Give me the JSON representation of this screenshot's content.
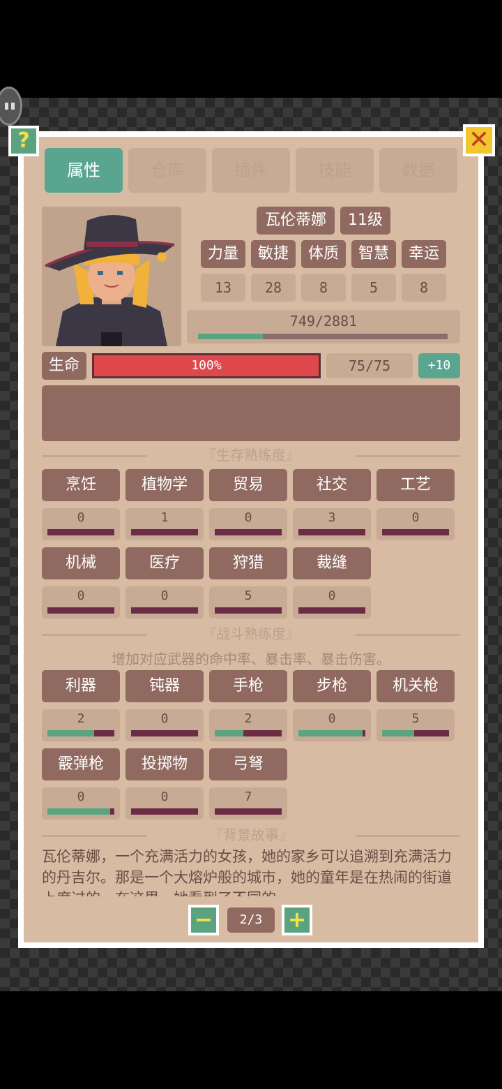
{
  "tabs": [
    {
      "label": "属性",
      "active": true
    },
    {
      "label": "仓库"
    },
    {
      "label": "插件"
    },
    {
      "label": "技能"
    },
    {
      "label": "数据"
    }
  ],
  "buttons": {
    "help": "?",
    "close": "✕",
    "prev": "−",
    "next": "+"
  },
  "character": {
    "name": "瓦伦蒂娜",
    "level": "11级",
    "xp_text": "749/2881",
    "xp_fraction": 0.26
  },
  "attributes": [
    {
      "label": "力量",
      "value": "13"
    },
    {
      "label": "敏捷",
      "value": "28"
    },
    {
      "label": "体质",
      "value": "8"
    },
    {
      "label": "智慧",
      "value": "5"
    },
    {
      "label": "幸运",
      "value": "8"
    }
  ],
  "health": {
    "label": "生命",
    "percent_text": "100%",
    "percent": 100,
    "value": "75/75",
    "bonus": "+10"
  },
  "survival": {
    "title": "『生存熟练度』",
    "skills": [
      {
        "name": "烹饪",
        "value": "0",
        "fill": 0
      },
      {
        "name": "植物学",
        "value": "1",
        "fill": 0
      },
      {
        "name": "贸易",
        "value": "0",
        "fill": 0
      },
      {
        "name": "社交",
        "value": "3",
        "fill": 0
      },
      {
        "name": "工艺",
        "value": "0",
        "fill": 0
      },
      {
        "name": "机械",
        "value": "0",
        "fill": 0
      },
      {
        "name": "医疗",
        "value": "0",
        "fill": 0
      },
      {
        "name": "狩猎",
        "value": "5",
        "fill": 0
      },
      {
        "name": "裁缝",
        "value": "0",
        "fill": 0
      }
    ]
  },
  "combat": {
    "title": "『战斗熟练度』",
    "subtitle": "增加对应武器的命中率、暴击率、暴击伤害。",
    "skills": [
      {
        "name": "利器",
        "value": "2",
        "fill": 0.7
      },
      {
        "name": "钝器",
        "value": "0",
        "fill": 0
      },
      {
        "name": "手枪",
        "value": "2",
        "fill": 0.43
      },
      {
        "name": "步枪",
        "value": "0",
        "fill": 0.96
      },
      {
        "name": "机关枪",
        "value": "5",
        "fill": 0.48
      },
      {
        "name": "霰弹枪",
        "value": "0",
        "fill": 0.94
      },
      {
        "name": "投掷物",
        "value": "0",
        "fill": 0
      },
      {
        "name": "弓弩",
        "value": "7",
        "fill": 0
      }
    ]
  },
  "background": {
    "title": "『背景故事』",
    "text": "瓦伦蒂娜，一个充满活力的女孩，她的家乡可以追溯到充满活力的丹吉尔。那是一个大熔炉般的城市，她的童年是在热闹的街道上度过的。在这里，她看到了不同的"
  },
  "pagination": {
    "text": "2/3"
  },
  "colors": {
    "accent": "#5aa58f",
    "hp": "#de484b",
    "panel": "#d7bba3",
    "chip": "#906a60"
  }
}
